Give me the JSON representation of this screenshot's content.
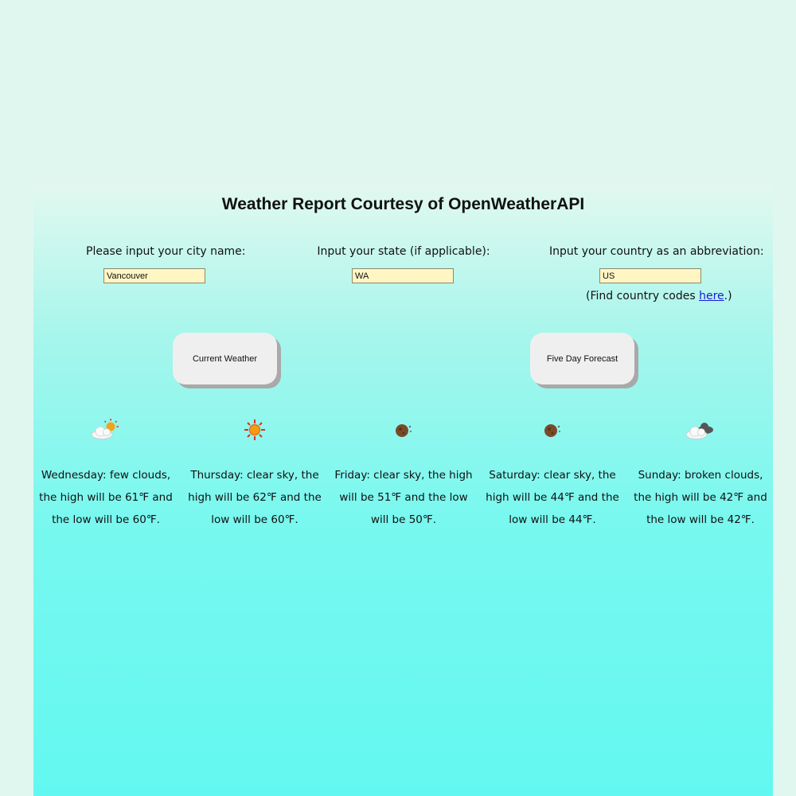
{
  "title": "Weather Report Courtesy of OpenWeatherAPI",
  "fields": {
    "city": {
      "label": "Please input your city name:",
      "value": "Vancouver"
    },
    "state": {
      "label": "Input your state (if applicable):",
      "value": "WA"
    },
    "country": {
      "label": "Input your country as an abbreviation:",
      "value": "US"
    }
  },
  "country_help": {
    "prefix": "(Find country codes ",
    "link": "here",
    "suffix": ".)"
  },
  "buttons": {
    "current": "Current Weather",
    "forecast": "Five Day Forecast"
  },
  "forecast": [
    {
      "icon": "few-clouds-icon",
      "text": "Wednesday: few clouds, the high will be 61℉ and the low will be 60℉."
    },
    {
      "icon": "clear-sky-day-icon",
      "text": "Thursday: clear sky, the high will be 62℉ and the low will be 60℉."
    },
    {
      "icon": "clear-sky-night-icon",
      "text": "Friday: clear sky, the high will be 51℉ and the low will be 50℉."
    },
    {
      "icon": "clear-sky-night-icon",
      "text": "Saturday: clear sky, the high will be 44℉ and the low will be 44℉."
    },
    {
      "icon": "broken-clouds-icon",
      "text": "Sunday: broken clouds, the high will be 42℉ and the low will be 42℉."
    }
  ]
}
